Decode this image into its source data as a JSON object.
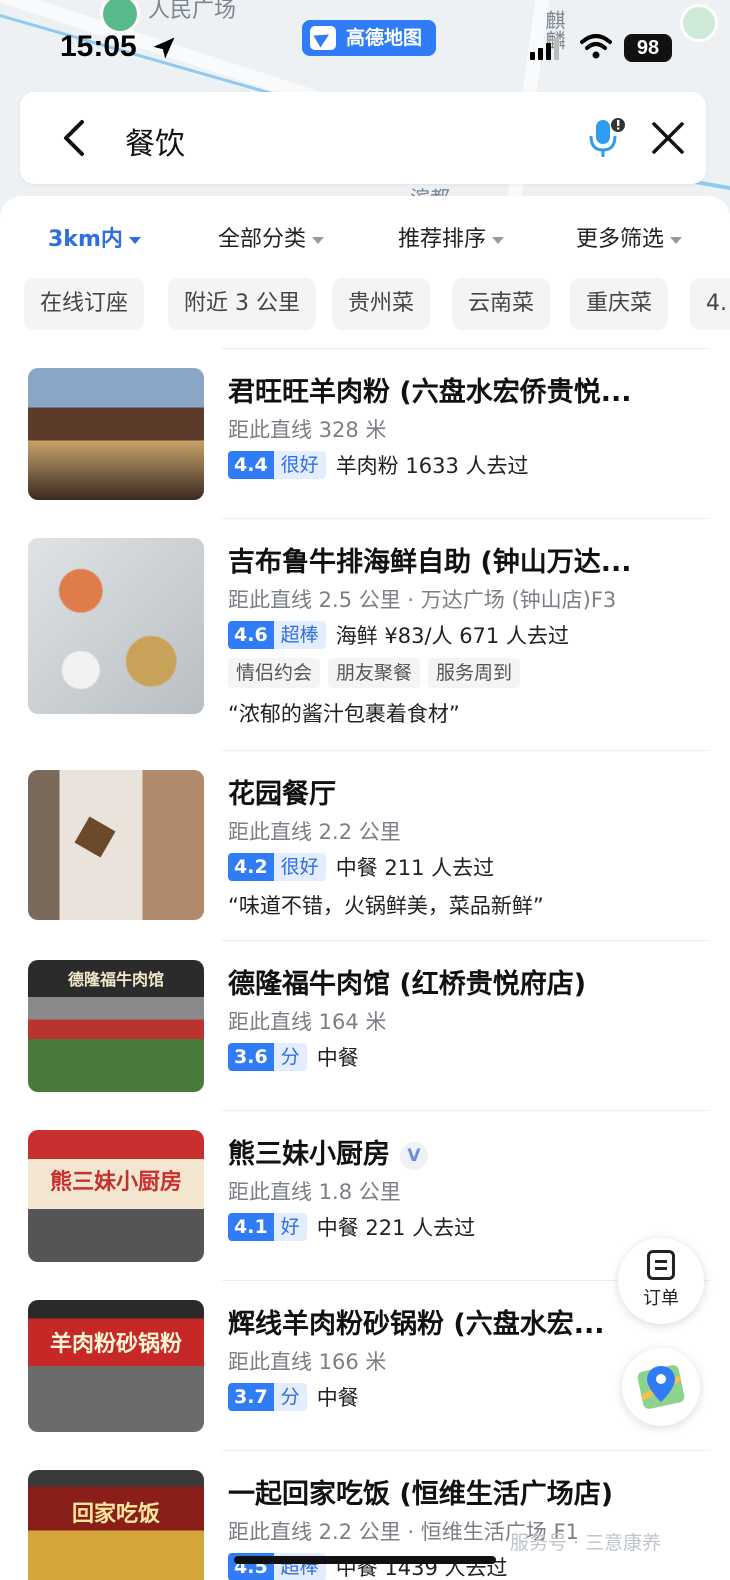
{
  "map": {
    "label_top": "人民广场",
    "label_mid": "滨都",
    "label_side": "麒麟"
  },
  "status_bar": {
    "time": "15:05",
    "app_name": "高德地图",
    "battery": "98"
  },
  "search": {
    "query": "餐饮"
  },
  "filters": [
    {
      "label": "3km内",
      "active": true
    },
    {
      "label": "全部分类",
      "active": false
    },
    {
      "label": "推荐排序",
      "active": false
    },
    {
      "label": "更多筛选",
      "active": false
    }
  ],
  "chips": [
    "在线订座",
    "附近 3 公里",
    "贵州菜",
    "云南菜",
    "重庆菜",
    "4."
  ],
  "results": [
    {
      "name": "君旺旺羊肉粉 (六盘水宏侨贵悦...",
      "distance": "距此直线 328 米",
      "score": "4.4",
      "score_label": "很好",
      "meta": "羊肉粉  1633 人去过",
      "thumb_colors": [
        "#8aa7c8",
        "#5c3b2b",
        "#c9a26b"
      ]
    },
    {
      "name": "吉布鲁牛排海鲜自助 (钟山万达...",
      "distance": "距此直线 2.5 公里 · 万达广场 (钟山店)F3",
      "score": "4.6",
      "score_label": "超棒",
      "meta": "海鲜  ¥83/人  671 人去过",
      "tags": [
        "情侣约会",
        "朋友聚餐",
        "服务周到"
      ],
      "quote": "“浓郁的酱汁包裹着食材”",
      "thumb_colors": [
        "#d9dde0",
        "#b9bec2",
        "#e07b4a"
      ]
    },
    {
      "name": "花园餐厅",
      "distance": "距此直线 2.2 公里",
      "score": "4.2",
      "score_label": "很好",
      "meta": "中餐  211 人去过",
      "quote": "“味道不错，火锅鲜美，菜品新鲜”",
      "thumb_colors": [
        "#b08a6a",
        "#e9e3dc",
        "#7a6a5c"
      ]
    },
    {
      "name": "德隆福牛肉馆 (红桥贵悦府店)",
      "distance": "距此直线 164 米",
      "score": "3.6",
      "score_label": "分",
      "meta": "中餐",
      "sign_text": "德隆福牛肉馆",
      "thumb_colors": [
        "#2b2b2b",
        "#b9342e",
        "#4a7a3a"
      ]
    },
    {
      "name": "熊三妹小厨房",
      "verified": "V",
      "distance": "距此直线 1.8 公里",
      "score": "4.1",
      "score_label": "好",
      "meta": "中餐  221 人去过",
      "sign_text": "熊三妹小厨房",
      "thumb_colors": [
        "#c8302f",
        "#f3e6d0",
        "#555"
      ]
    },
    {
      "name": "辉线羊肉粉砂锅粉 (六盘水宏...",
      "distance": "距此直线 166 米",
      "score": "3.7",
      "score_label": "分",
      "meta": "中餐",
      "sign_text": "羊肉粉砂锅粉",
      "thumb_colors": [
        "#c62828",
        "#2a2a2a",
        "#6b6b6b"
      ]
    },
    {
      "name": "一起回家吃饭 (恒维生活广场店)",
      "distance": "距此直线 2.2 公里 · 恒维生活广场 F1",
      "score": "4.5",
      "score_label": "超棒",
      "meta": "中餐  1439 人去过",
      "sign_text": "回家吃饭",
      "thumb_colors": [
        "#8a1f1a",
        "#d4a53a",
        "#3a3a3a"
      ]
    }
  ],
  "floating": {
    "order_label": "订单"
  },
  "watermark": "服务号 · 三意康养",
  "colors": {
    "accent": "#2f7cf6",
    "active_filter": "#2f6fe0"
  }
}
